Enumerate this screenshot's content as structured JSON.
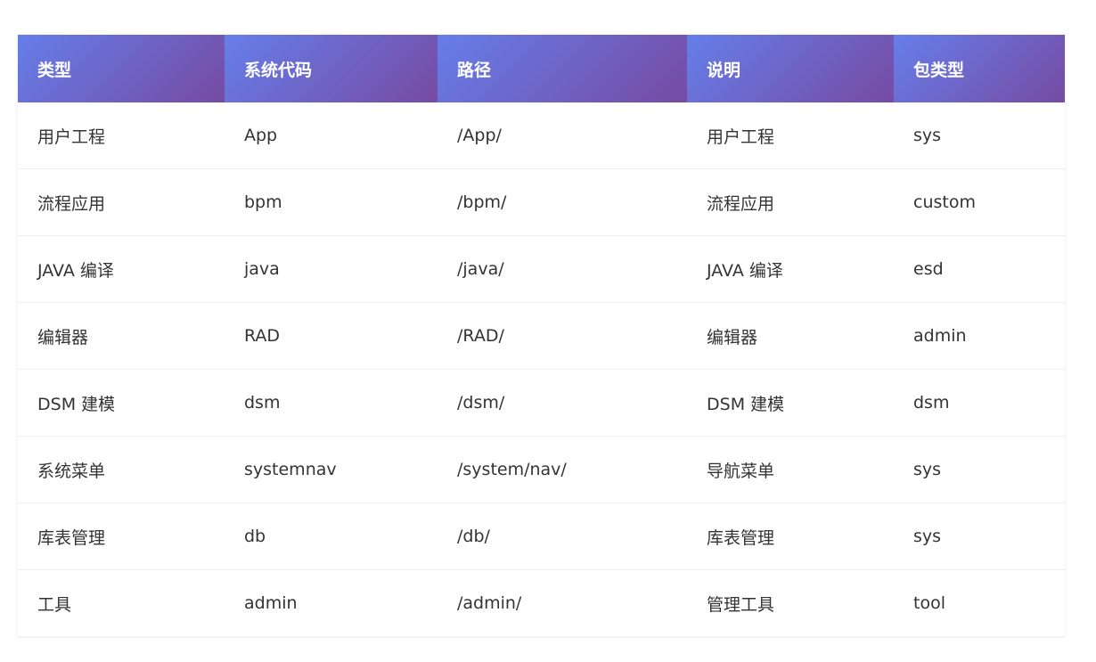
{
  "table": {
    "headers": [
      "类型",
      "系统代码",
      "路径",
      "说明",
      "包类型"
    ],
    "rows": [
      [
        "用户工程",
        "App",
        "/App/",
        "用户工程",
        "sys"
      ],
      [
        "流程应用",
        "bpm",
        "/bpm/",
        "流程应用",
        "custom"
      ],
      [
        "JAVA 编译",
        "java",
        "/java/",
        "JAVA 编译",
        "esd"
      ],
      [
        "编辑器",
        "RAD",
        "/RAD/",
        "编辑器",
        "admin"
      ],
      [
        "DSM 建模",
        "dsm",
        "/dsm/",
        "DSM 建模",
        "dsm"
      ],
      [
        "系统菜单",
        "systemnav",
        "/system/nav/",
        "导航菜单",
        "sys"
      ],
      [
        "库表管理",
        "db",
        "/db/",
        "库表管理",
        "sys"
      ],
      [
        "工具",
        "admin",
        "/admin/",
        "管理工具",
        "tool"
      ]
    ]
  },
  "colors": {
    "header_gradient_start": "#667eea",
    "header_gradient_end": "#764ba2",
    "header_text": "#ffffff",
    "body_text": "#333333",
    "row_divider": "#eeeeee"
  }
}
